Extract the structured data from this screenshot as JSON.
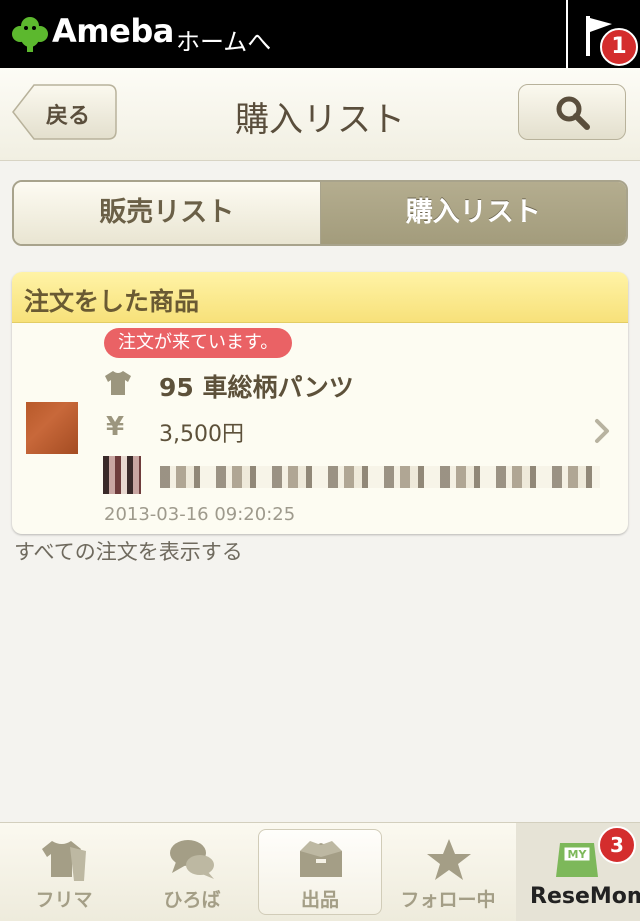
{
  "ameba_bar": {
    "brand": "Ameba",
    "home_link": "ホームへ",
    "notification_count": "1"
  },
  "nav": {
    "back_label": "戻る",
    "title": "購入リスト"
  },
  "segment": {
    "sell_label": "販売リスト",
    "buy_label": "購入リスト"
  },
  "order_card": {
    "section_title": "注文をした商品",
    "status_badge": "注文が来ています。",
    "item_name": "95 車総柄パンツ",
    "currency_symbol": "¥",
    "price": "3,500円",
    "timestamp": "2013-03-16 09:20:25"
  },
  "show_all_link": "すべての注文を表示する",
  "tabbar": {
    "items": [
      {
        "label": "フリマ"
      },
      {
        "label": "ひろば"
      },
      {
        "label": "出品"
      },
      {
        "label": "フォロー中"
      },
      {
        "label": "MY"
      }
    ],
    "my_badge": "3"
  },
  "watermark": "ReseMom",
  "colors": {
    "accent_red": "#d42d2d",
    "header_yellow": "#f7e17a",
    "text_brown": "#5a4e3c"
  }
}
